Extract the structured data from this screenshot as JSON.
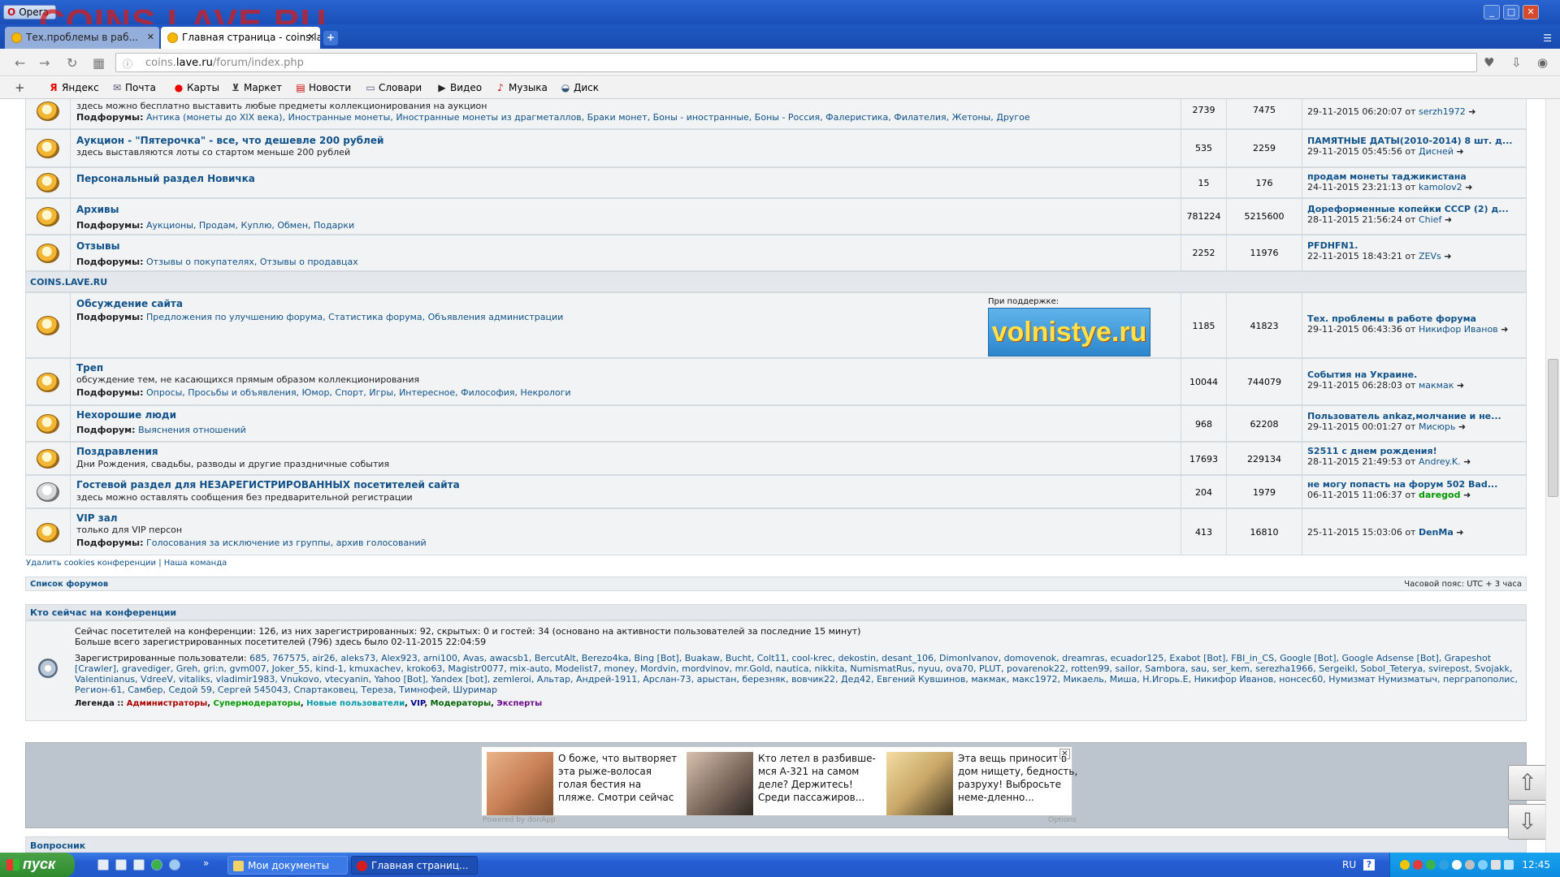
{
  "window": {
    "opera_label": "Opera",
    "watermark": "COINS.LAVE.RU"
  },
  "tabs": [
    {
      "label": "Тех.проблемы в раб..."
    },
    {
      "label": "Главная страница - coins.lave.ru"
    }
  ],
  "address": {
    "domain_pre": "coins.",
    "domain": "lave.ru",
    "path": "/forum/index.php"
  },
  "bookmarks": [
    "Яндекс",
    "Почта",
    "Карты",
    "Маркет",
    "Новости",
    "Словари",
    "Видео",
    "Музыка",
    "Диск"
  ],
  "forums_top": [
    {
      "title": "",
      "desc": "здесь можно бесплатно выставить любые предметы коллекционирования на аукцион",
      "sub_label": "Подфорумы:",
      "sub": "Антика (монеты до XIX века), Иностранные монеты, Иностранные монеты из драгметаллов, Браки монет, Боны - иностранные, Боны - Россия, Фалеристика, Филателия, Жетоны, Другое",
      "topics": "2739",
      "posts": "7475",
      "last_title": "",
      "last_meta": "29-11-2015 06:20:07 от",
      "last_user": "serzh1972"
    },
    {
      "title": "Аукцион - \"Пятерочка\" - все, что дешевле 200 рублей",
      "desc": "здесь выставляются лоты со стартом меньше 200 рублей",
      "sub_label": "",
      "sub": "",
      "topics": "535",
      "posts": "2259",
      "last_title": "ПАМЯТНЫЕ ДАТЫ(2010-2014) 8 шт. д...",
      "last_meta": "29-11-2015 05:45:56 от",
      "last_user": "Дисней"
    },
    {
      "title": "Персональный раздел Новичка",
      "desc": "",
      "sub_label": "",
      "sub": "",
      "topics": "15",
      "posts": "176",
      "last_title": "продам монеты таджикистана",
      "last_meta": "24-11-2015 23:21:13 от",
      "last_user": "kamolov2"
    },
    {
      "title": "Архивы",
      "desc": "",
      "sub_label": "Подфорумы:",
      "sub": "Аукционы, Продам, Куплю, Обмен, Подарки",
      "topics": "781224",
      "posts": "5215600",
      "last_title": "Дореформенные копейки СССР (2) д...",
      "last_meta": "28-11-2015 21:56:24 от",
      "last_user": "Chief"
    },
    {
      "title": "Отзывы",
      "desc": "",
      "sub_label": "Подфорумы:",
      "sub": "Отзывы о покупателях, Отзывы о продавцах",
      "topics": "2252",
      "posts": "11976",
      "last_title": "PFDHFN1.",
      "last_meta": "22-11-2015 18:43:21 от",
      "last_user": "ZEVs"
    }
  ],
  "section_title": "COINS.LAVE.RU",
  "sponsor": {
    "label": "При поддержке:",
    "banner": "volnistye.ru"
  },
  "forums_bottom": [
    {
      "title": "Обсуждение сайта",
      "desc": "",
      "sub_label": "Подфорумы:",
      "sub": "Предложения по улучшению форума, Статистика форума, Объявления администрации",
      "topics": "1185",
      "posts": "41823",
      "last_title": "Тех. проблемы в работе форума",
      "last_meta": "29-11-2015 06:43:36 от",
      "last_user": "Никифор Иванов"
    },
    {
      "title": "Треп",
      "desc": "обсуждение тем, не касающихся прямым образом коллекционирования",
      "sub_label": "Подфорумы:",
      "sub": "Опросы, Просьбы и объявления, Юмор, Спорт, Игры, Интересное, Философия, Некрологи",
      "topics": "10044",
      "posts": "744079",
      "last_title": "События на Украине.",
      "last_meta": "29-11-2015 06:28:03 от",
      "last_user": "макмак"
    },
    {
      "title": "Нехорошие люди",
      "desc": "",
      "sub_label": "Подфорум:",
      "sub": "Выяснения отношений",
      "topics": "968",
      "posts": "62208",
      "last_title": "Пользователь ankaz,молчание и не...",
      "last_meta": "29-11-2015 00:01:27 от",
      "last_user": "Мисюрь"
    },
    {
      "title": "Поздравления",
      "desc": "Дни Рождения, свадьбы, разводы и другие праздничные события",
      "sub_label": "",
      "sub": "",
      "topics": "17693",
      "posts": "229134",
      "last_title": "S2511 с днем рождения!",
      "last_meta": "28-11-2015 21:49:53 от",
      "last_user": "Andrey.K."
    },
    {
      "title": "Гостевой раздел для НЕЗАРЕГИСТРИРОВАННЫХ посетителей сайта",
      "desc": "здесь можно оставлять сообщения без предварительной регистрации",
      "sub_label": "",
      "sub": "",
      "topics": "204",
      "posts": "1979",
      "last_title": "не могу попасть на форум 502 Bad...",
      "last_meta": "06-11-2015 11:06:37 от",
      "last_user": "daregod"
    },
    {
      "title": "VIP зал",
      "desc": "только для VIP персон",
      "sub_label": "Подфорумы:",
      "sub": "Голосования за исключение из группы, архив голосований",
      "topics": "413",
      "posts": "16810",
      "last_title": "",
      "last_meta": "25-11-2015 15:03:06 от",
      "last_user": "DenMa"
    }
  ],
  "links": {
    "delete_cookies": "Удалить cookies конференции",
    "team": "Наша команда",
    "forum_list": "Список форумов",
    "timezone": "Часовой пояс: UTC + 3 часа"
  },
  "online": {
    "header": "Кто сейчас на конференции",
    "stats1": "Сейчас посетителей на конференции: 126, из них зарегистрированных: 92, скрытых: 0 и гостей: 34 (основано на активности пользователей за последние 15 минут)",
    "stats2": "Больше всего зарегистрированных посетителей (796) здесь было 02-11-2015 22:04:59",
    "users_label": "Зарегистрированные пользователи:",
    "users": "685, 767575, air26, aleks73, Alex923, arni100, Avas, awacsb1, BercutAlt, Berezo4ka, Bing [Bot], Buakaw, Bucht, Colt11, cool-krec, dekostin, desant_106, DimonIvanov, domovenok, dreamras, ecuador125, Exabot [Bot], FBI_in_CS, Google [Bot], Google Adsense [Bot], Grapeshot [Crawler], gravediger, Greh, gri:n, gvm007, Joker_55, kind-1, kmuxachev, kroko63, Magistr0077, mix-auto, Modelist7, money, Mordvin, mordvinov, mr.Gold, nautica, nikkita, NumismatRus, nyuu, ova70, PLUT, povarenok22, rotten99, sailor, Sambora, sau, ser_kem, serezha1966, SergeikI, Sobol_Teterya, svirepost, Svojakk, Valentinianus, VdreeV, vitaliks, vladimir1983, Vnukovo, vtecyanin, Yahoo [Bot], Yandex [bot], zemleroi, Альтар, Андрей-1911, Арслан-73, арыстан, березняк, вовчик22, Дед42, Евгений Кувшинов, макмак, макс1972, Микаель, Миша, Н.Игорь.Е, Никифор Иванов, нонсес60, Нумизмат Нумизматыч, перграпополис, Регион-61, Самбер, Седой 59, Сергей 545043, Спартаковец, Тереза, Тимнофей, Шуримар",
    "legend_label": "Легенда ::",
    "legend": [
      "Администраторы",
      "Супермодераторы",
      "Новые пользователи",
      "VIP",
      "Модераторы",
      "Эксперты"
    ]
  },
  "ads": [
    {
      "text": "О боже, что вытворяет эта рыже-волосая голая бестия на пляже. Смотри сейчас"
    },
    {
      "text": "Кто летел в разбивше-мся А-321 на самом деле? Держитесь! Среди пассажиров..."
    },
    {
      "text": "Эта вещь приносит в дом нищету, бедность, разруху! Выбросьте неме-дленно..."
    }
  ],
  "ad_footer": "Powered by donApp",
  "ad_options": "Options",
  "cutoff_label": "Вопросник",
  "taskbar": {
    "start": "пуск",
    "task1": "Мои документы",
    "task2": "Главная страниц...",
    "lang": "RU",
    "clock": "12:45"
  }
}
